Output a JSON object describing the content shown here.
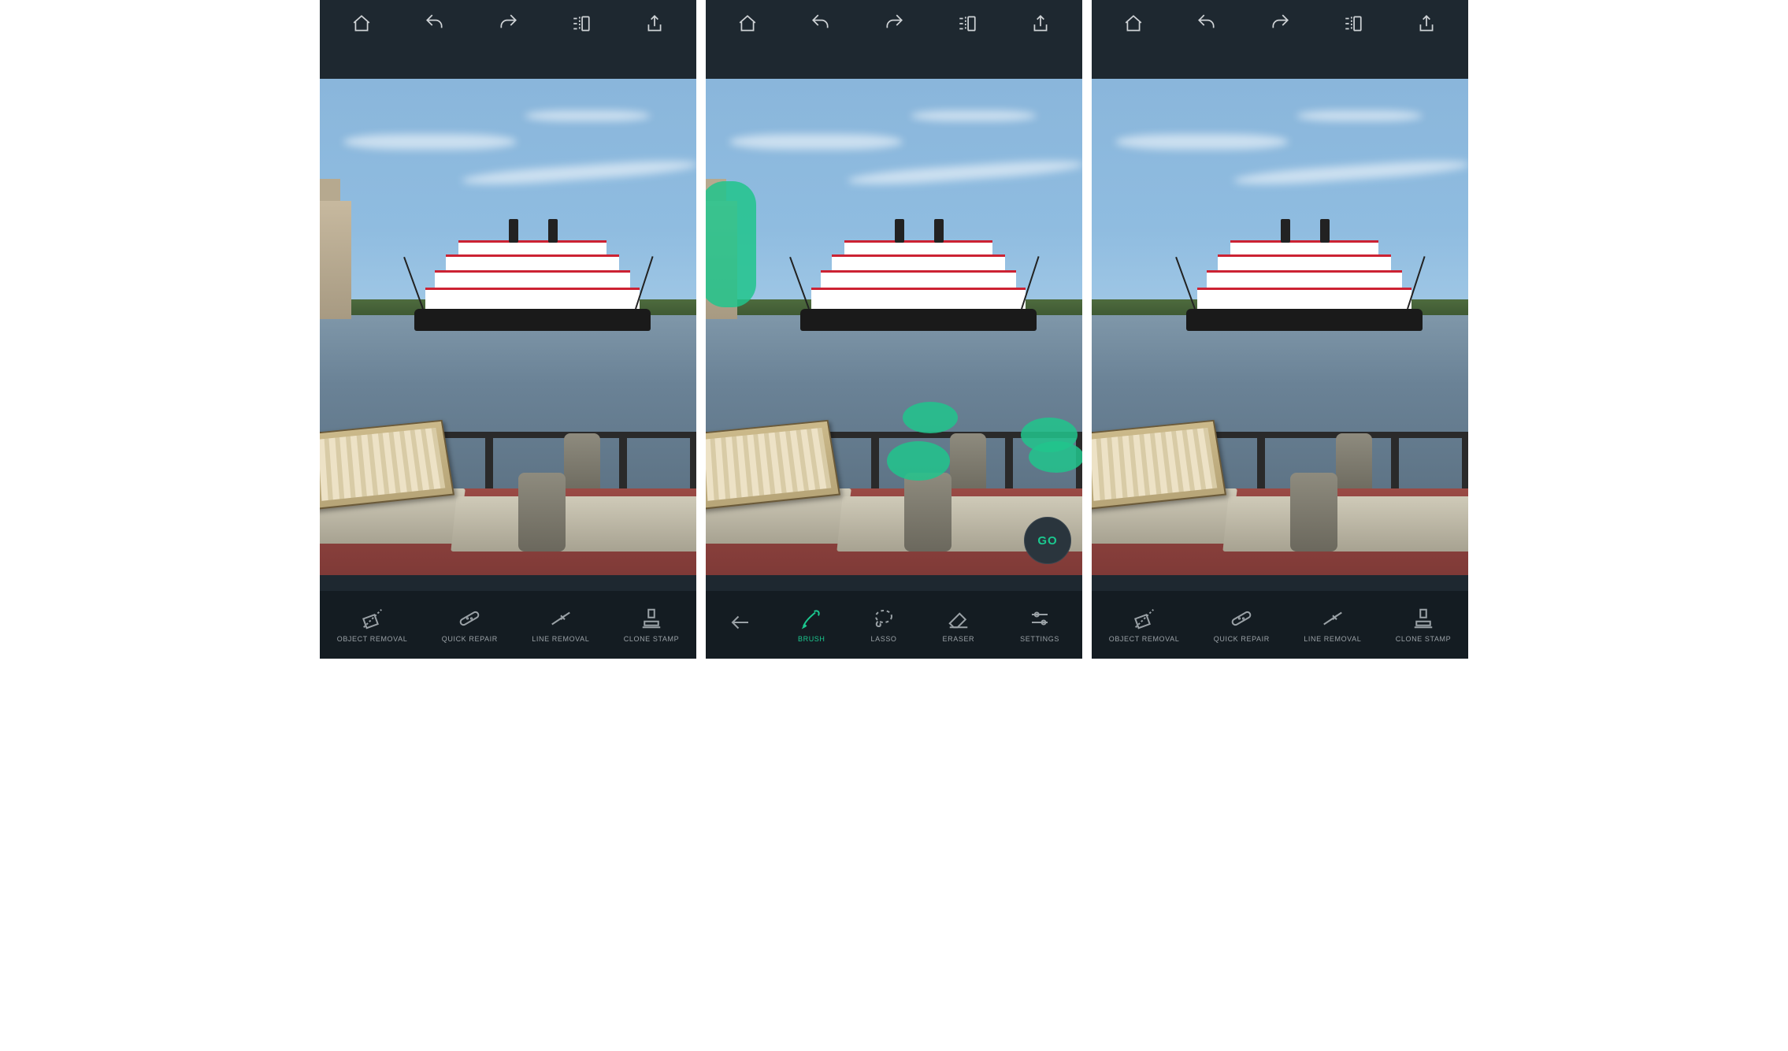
{
  "colors": {
    "bg": "#1e2830",
    "bar": "#141c22",
    "accent": "#1bc88f"
  },
  "topbar": {
    "home": "home-icon",
    "undo": "undo-icon",
    "redo": "redo-icon",
    "compare": "compare-icon",
    "share": "share-icon"
  },
  "panels": [
    {
      "id": "before",
      "has_building": true,
      "overlays": false,
      "go_visible": false,
      "toolbar": "main",
      "tools": [
        {
          "key": "object_removal",
          "label": "OBJECT REMOVAL"
        },
        {
          "key": "quick_repair",
          "label": "QUICK REPAIR"
        },
        {
          "key": "line_removal",
          "label": "LINE REMOVAL"
        },
        {
          "key": "clone_stamp",
          "label": "CLONE STAMP"
        }
      ]
    },
    {
      "id": "brush",
      "has_building": true,
      "overlays": true,
      "go_visible": true,
      "go_label": "GO",
      "toolbar": "object_removal",
      "tools": [
        {
          "key": "back",
          "label": ""
        },
        {
          "key": "brush",
          "label": "BRUSH",
          "active": true
        },
        {
          "key": "lasso",
          "label": "LASSO"
        },
        {
          "key": "eraser",
          "label": "ERASER"
        },
        {
          "key": "settings",
          "label": "SETTINGS"
        }
      ]
    },
    {
      "id": "after",
      "has_building": false,
      "overlays": false,
      "go_visible": false,
      "toolbar": "main",
      "tools": [
        {
          "key": "object_removal",
          "label": "OBJECT REMOVAL"
        },
        {
          "key": "quick_repair",
          "label": "QUICK REPAIR"
        },
        {
          "key": "line_removal",
          "label": "LINE REMOVAL"
        },
        {
          "key": "clone_stamp",
          "label": "CLONE STAMP"
        }
      ]
    }
  ]
}
